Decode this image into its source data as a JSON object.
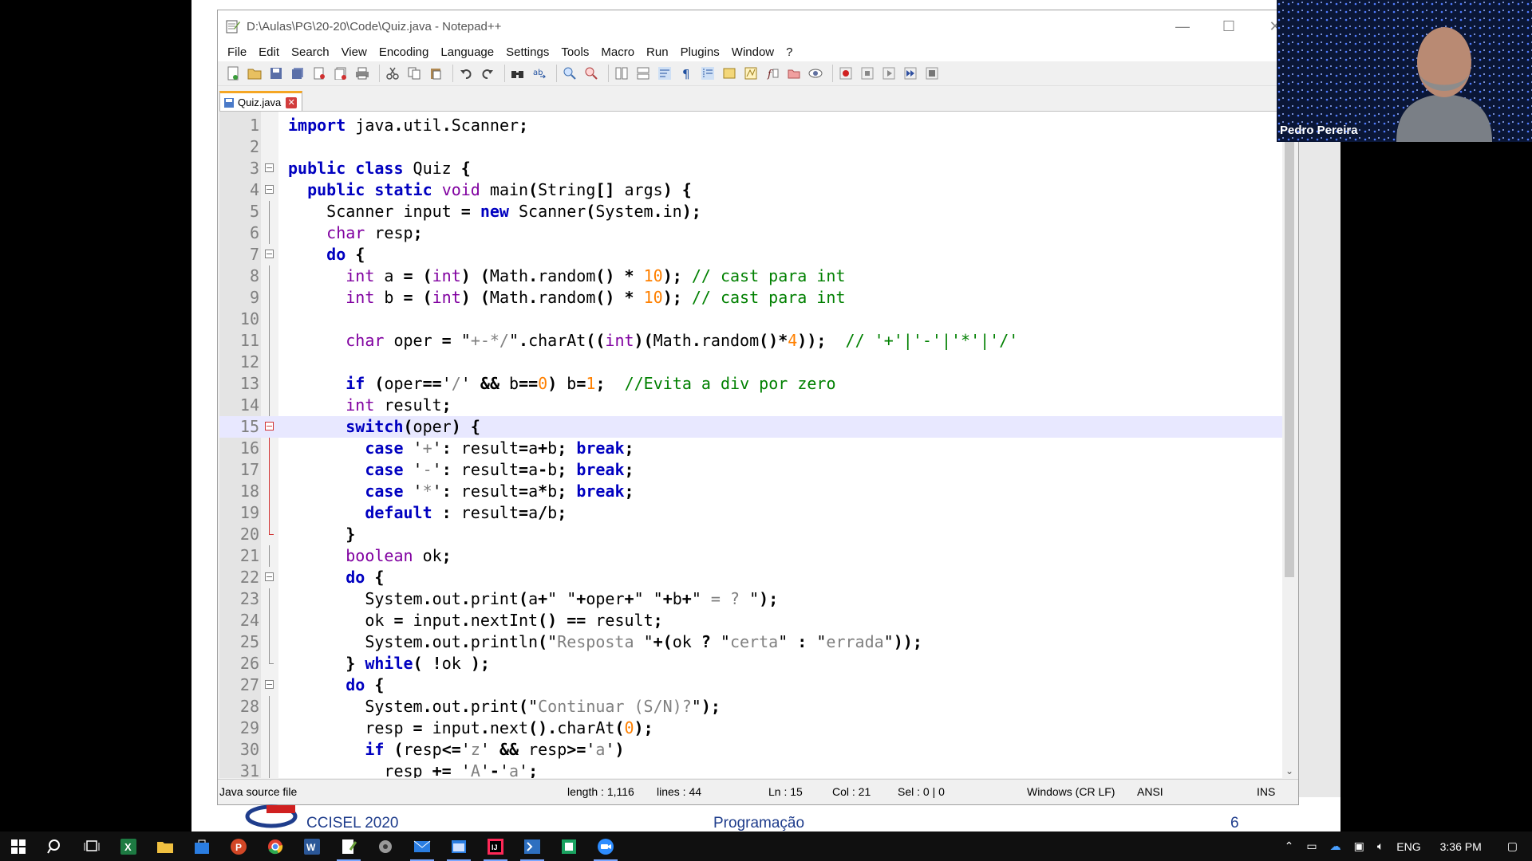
{
  "window": {
    "title": "D:\\Aulas\\PG\\20-20\\Code\\Quiz.java - Notepad++",
    "minimize_glyph": "—",
    "maximize_glyph": "☐",
    "close_glyph": "✕"
  },
  "menu": [
    "File",
    "Edit",
    "Search",
    "View",
    "Encoding",
    "Language",
    "Settings",
    "Tools",
    "Macro",
    "Run",
    "Plugins",
    "Window",
    "?"
  ],
  "tab": {
    "label": "Quiz.java",
    "close_glyph": "✕"
  },
  "editor": {
    "current_line": 15,
    "lines": [
      {
        "n": "1",
        "code": "import java.util.Scanner;"
      },
      {
        "n": "2",
        "code": ""
      },
      {
        "n": "3",
        "code": "public class Quiz {"
      },
      {
        "n": "4",
        "code": "  public static void main(String[] args) {"
      },
      {
        "n": "5",
        "code": "    Scanner input = new Scanner(System.in);"
      },
      {
        "n": "6",
        "code": "    char resp;"
      },
      {
        "n": "7",
        "code": "    do {"
      },
      {
        "n": "8",
        "code": "      int a = (int) (Math.random() * 10); // cast para int"
      },
      {
        "n": "9",
        "code": "      int b = (int) (Math.random() * 10); // cast para int"
      },
      {
        "n": "10",
        "code": ""
      },
      {
        "n": "11",
        "code": "      char oper = \"+-*/\".charAt((int)(Math.random()*4));  // '+'|'-'|'*'|'/'"
      },
      {
        "n": "12",
        "code": ""
      },
      {
        "n": "13",
        "code": "      if (oper=='/' && b==0) b=1;  //Evita a div por zero"
      },
      {
        "n": "14",
        "code": "      int result;"
      },
      {
        "n": "15",
        "code": "      switch(oper) {"
      },
      {
        "n": "16",
        "code": "        case '+': result=a+b; break;"
      },
      {
        "n": "17",
        "code": "        case '-': result=a-b; break;"
      },
      {
        "n": "18",
        "code": "        case '*': result=a*b; break;"
      },
      {
        "n": "19",
        "code": "        default : result=a/b;"
      },
      {
        "n": "20",
        "code": "      }"
      },
      {
        "n": "21",
        "code": "      boolean ok;"
      },
      {
        "n": "22",
        "code": "      do {"
      },
      {
        "n": "23",
        "code": "        System.out.print(a+\" \"+oper+\" \"+b+\" = ? \");"
      },
      {
        "n": "24",
        "code": "        ok = input.nextInt() == result;"
      },
      {
        "n": "25",
        "code": "        System.out.println(\"Resposta \"+(ok ? \"certa\" : \"errada\"));"
      },
      {
        "n": "26",
        "code": "      } while( !ok );"
      },
      {
        "n": "27",
        "code": "      do {"
      },
      {
        "n": "28",
        "code": "        System.out.print(\"Continuar (S/N)?\");"
      },
      {
        "n": "29",
        "code": "        resp = input.next().charAt(0);"
      },
      {
        "n": "30",
        "code": "        if (resp<='z' && resp>='a')"
      },
      {
        "n": "31",
        "code": "          resp += 'A'-'a';"
      }
    ]
  },
  "status": {
    "file_type": "Java source file",
    "length": "length : 1,116",
    "lines": "lines : 44",
    "ln": "Ln : 15",
    "col": "Col : 21",
    "sel": "Sel : 0 | 0",
    "eol": "Windows (CR LF)",
    "encoding": "ANSI",
    "mode": "INS"
  },
  "slide_footer": {
    "left": "CCISEL 2020",
    "middle": "Programação",
    "page": "6"
  },
  "webcam": {
    "name": "Pedro Pereira"
  },
  "taskbar": {
    "language": "ENG",
    "time": "3:36 PM"
  },
  "colors": {
    "keyword_bold": "#0000c0",
    "type_purple": "#8000a0",
    "string_gray": "#808080",
    "comment_green": "#008000",
    "number_orange": "#ff8000",
    "current_line": "#e8e8ff"
  }
}
